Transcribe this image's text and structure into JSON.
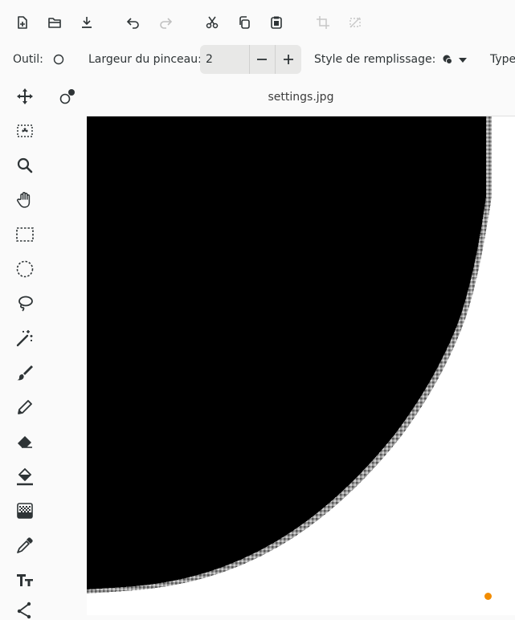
{
  "toolbar": {
    "buttons": [
      {
        "name": "new-file",
        "icon": "new-file-icon",
        "enabled": true
      },
      {
        "name": "open-file",
        "icon": "folder-open-icon",
        "enabled": true
      },
      {
        "name": "save-file",
        "icon": "download-icon",
        "enabled": true
      },
      {
        "name": "undo",
        "icon": "undo-icon",
        "enabled": true
      },
      {
        "name": "redo",
        "icon": "redo-icon",
        "enabled": false
      },
      {
        "name": "cut",
        "icon": "cut-icon",
        "enabled": true
      },
      {
        "name": "copy",
        "icon": "copy-icon",
        "enabled": true
      },
      {
        "name": "paste",
        "icon": "paste-icon",
        "enabled": true
      },
      {
        "name": "crop",
        "icon": "crop-icon",
        "enabled": false
      },
      {
        "name": "deselect",
        "icon": "deselect-icon",
        "enabled": false
      }
    ]
  },
  "options": {
    "tool_label": "Outil:",
    "tool_icon": "ellipse-icon",
    "brush_width_label": "Largeur du pinceau:",
    "brush_width_value": "2",
    "fill_style_label": "Style de remplissage:",
    "type_label": "Type"
  },
  "sidebar": {
    "tools": [
      "move-selected",
      "move-selection",
      "zoom",
      "pan",
      "rectangle-select",
      "ellipse-select",
      "lasso-select",
      "magic-wand",
      "paintbrush",
      "pencil",
      "eraser",
      "paint-bucket",
      "gradient",
      "color-picker",
      "text",
      "line-curve"
    ]
  },
  "document": {
    "title": "settings.jpg"
  },
  "colors": {
    "primary": "#000000",
    "secondary": "#ffffff",
    "accent_dot": "#f28c00"
  }
}
